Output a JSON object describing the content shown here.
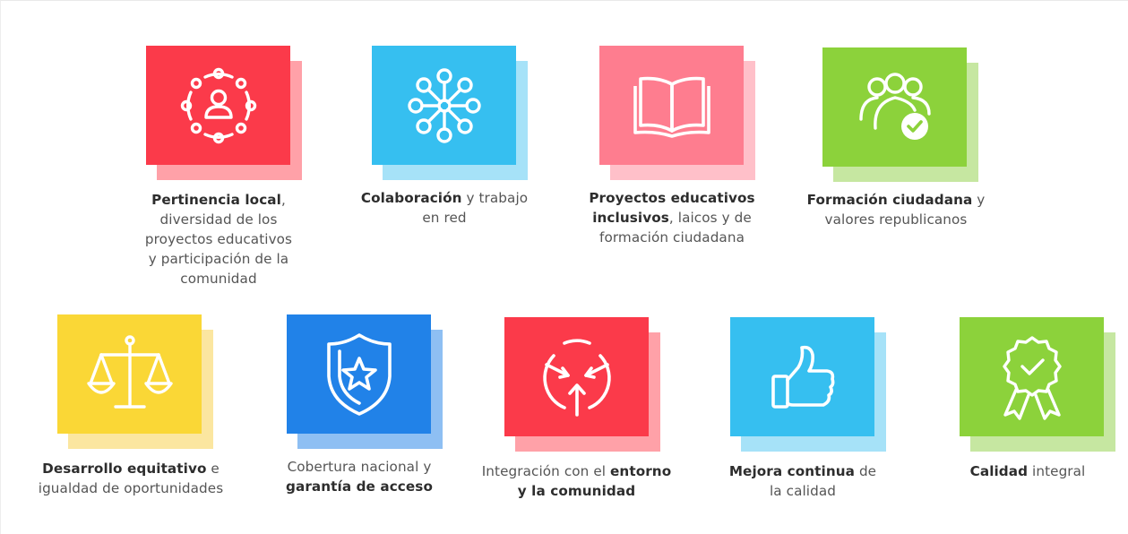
{
  "colors": {
    "red": "#fb3a4a",
    "red_shadow": "#ffa1a8",
    "blue": "#36bff0",
    "blue_shadow": "#a6e2f8",
    "pink": "#fe7d8f",
    "pink_shadow": "#ffc0c9",
    "green": "#8cd23b",
    "green_shadow": "#c6e7a1",
    "yellow": "#fad736",
    "yellow_shadow": "#fbe6a0",
    "dark_blue": "#2182e8",
    "dark_blue_shadow": "#8ebff3"
  },
  "cards": [
    {
      "icon": "community-people-icon",
      "caption": [
        {
          "bold": "Pertinencia local",
          "rest": ","
        },
        {
          "bold": "",
          "rest": "diversidad de los"
        },
        {
          "bold": "",
          "rest": "proyectos educativos"
        },
        {
          "bold": "",
          "rest": "y participación de la"
        },
        {
          "bold": "",
          "rest": "comunidad"
        }
      ]
    },
    {
      "icon": "network-nodes-icon",
      "caption": [
        {
          "bold": "Colaboración",
          "rest": " y trabajo"
        },
        {
          "bold": "",
          "rest": "en red"
        }
      ]
    },
    {
      "icon": "open-book-icon",
      "caption": [
        {
          "bold": "Proyectos educativos",
          "rest": ""
        },
        {
          "bold": "inclusivos",
          "rest": ", laicos y de"
        },
        {
          "bold": "",
          "rest": "formación ciudadana"
        }
      ]
    },
    {
      "icon": "group-check-icon",
      "caption": [
        {
          "bold": "Formación ciudadana",
          "rest": " y"
        },
        {
          "bold": "",
          "rest": "valores republicanos"
        }
      ]
    },
    {
      "icon": "balance-scale-icon",
      "caption": [
        {
          "bold": "Desarrollo equitativo",
          "rest": " e"
        },
        {
          "bold": "",
          "rest": "igualdad de oportunidades"
        }
      ]
    },
    {
      "icon": "shield-star-icon",
      "caption": [
        {
          "bold": "",
          "rest": "Cobertura nacional y"
        },
        {
          "bold": "garantía de acceso",
          "rest": ""
        }
      ]
    },
    {
      "icon": "converging-arrows-icon",
      "caption": [
        {
          "bold": "",
          "rest": "Integración con el ",
          "bold2": "entorno"
        },
        {
          "bold": "y la comunidad",
          "rest": ""
        }
      ]
    },
    {
      "icon": "thumbs-up-icon",
      "caption": [
        {
          "bold": "Mejora continua",
          "rest": " de"
        },
        {
          "bold": "",
          "rest": "la calidad"
        }
      ]
    },
    {
      "icon": "quality-badge-icon",
      "caption": [
        {
          "bold": "Calidad",
          "rest": " integral"
        }
      ]
    }
  ]
}
